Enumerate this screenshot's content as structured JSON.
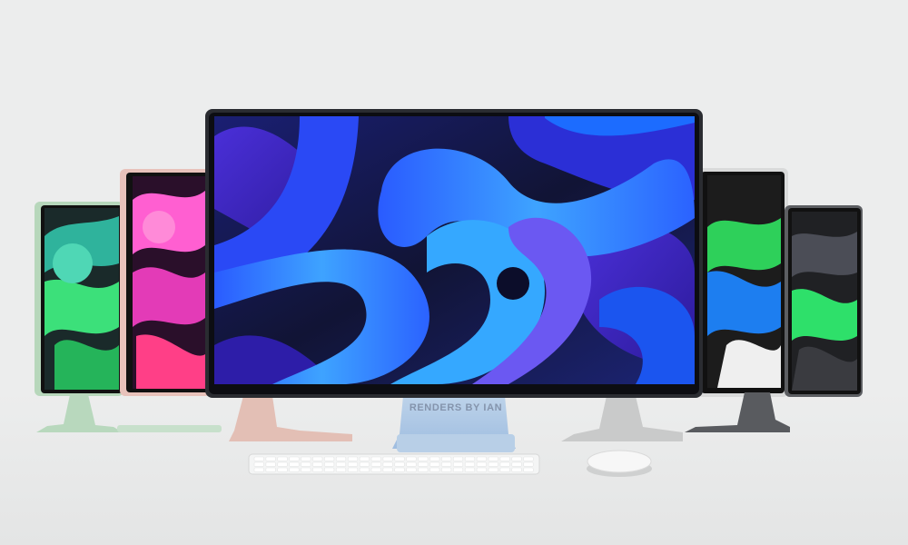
{
  "scene": {
    "watermark": "RENDERS BY IAN",
    "background_color": "#eceded",
    "monitors": [
      {
        "position": "far-left",
        "color_name": "green",
        "frame_color": "#b7d7bb",
        "stand_color": "#b8d8bd"
      },
      {
        "position": "left",
        "color_name": "pink",
        "frame_color": "#e8c2bb",
        "stand_color": "#e3bfb5"
      },
      {
        "position": "center",
        "color_name": "blue",
        "frame_color": "#2a2c31",
        "stand_color": "#a9c6e4"
      },
      {
        "position": "right",
        "color_name": "silver",
        "frame_color": "#d9dada",
        "stand_color": "#c9caca"
      },
      {
        "position": "far-right",
        "color_name": "space-gray",
        "frame_color": "#5c5e62",
        "stand_color": "#595b5f"
      }
    ],
    "accessories": [
      "keyboard",
      "mouse"
    ]
  }
}
